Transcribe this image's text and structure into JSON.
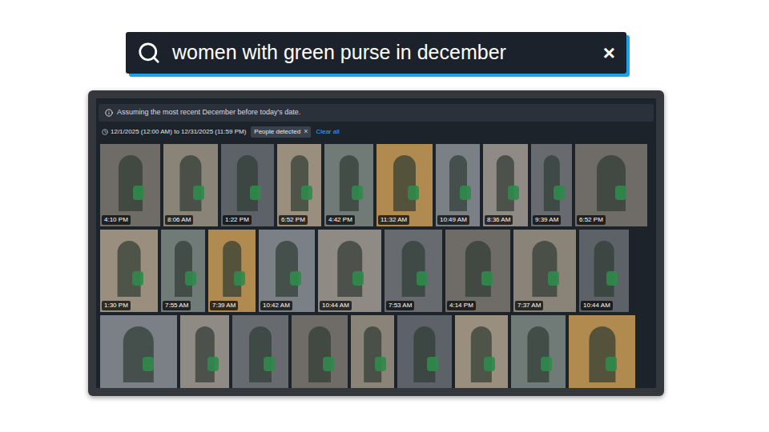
{
  "search": {
    "query": "women with green purse in december",
    "clear": "×"
  },
  "results": {
    "notice": "Assuming the most recent December before today's date.",
    "filters": {
      "date_range": "12/1/2025 (12:00 AM) to 12/31/2025 (11:59 PM)",
      "chips": [
        {
          "label": "People detected",
          "remove": "×"
        }
      ],
      "clear_all": "Clear all"
    },
    "rows": [
      [
        {
          "time": "4:10 PM"
        },
        {
          "time": "8:06 AM"
        },
        {
          "time": "1:22 PM"
        },
        {
          "time": "6:52 PM"
        },
        {
          "time": "4:42 PM"
        },
        {
          "time": "11:32 AM"
        },
        {
          "time": "10:49 AM"
        },
        {
          "time": "8:36 AM"
        },
        {
          "time": "9:39 AM"
        },
        {
          "time": "6:52 PM"
        }
      ],
      [
        {
          "time": "1:30 PM"
        },
        {
          "time": "7:55 AM"
        },
        {
          "time": "7:39 AM"
        },
        {
          "time": "10:42 AM"
        },
        {
          "time": "10:44 AM"
        },
        {
          "time": "7:53 AM"
        },
        {
          "time": "4:14 PM"
        },
        {
          "time": "7:37 AM"
        },
        {
          "time": "10:44 AM"
        }
      ],
      [
        {
          "time": ""
        },
        {
          "time": ""
        },
        {
          "time": ""
        },
        {
          "time": ""
        },
        {
          "time": ""
        },
        {
          "time": ""
        },
        {
          "time": ""
        },
        {
          "time": ""
        },
        {
          "time": ""
        }
      ]
    ]
  }
}
